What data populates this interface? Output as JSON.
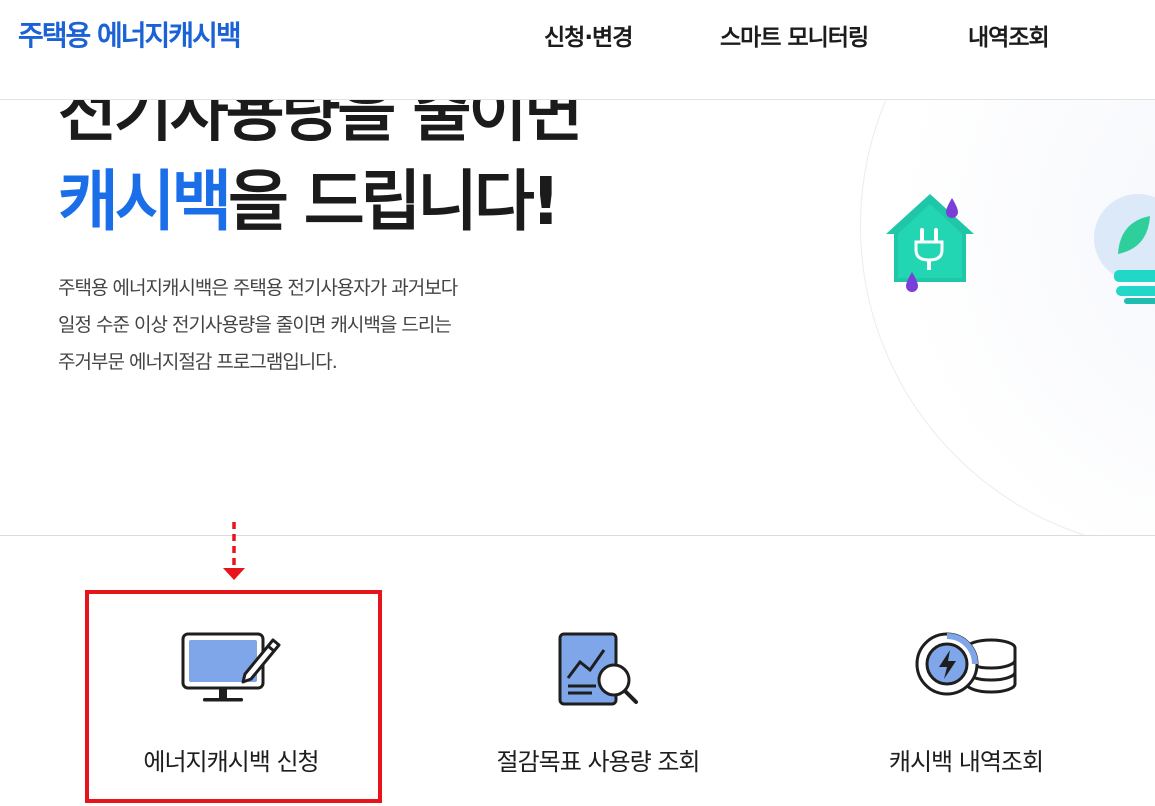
{
  "header": {
    "logo": "주택용 에너지캐시백",
    "nav": [
      "신청·변경",
      "스마트 모니터링",
      "내역조회"
    ]
  },
  "hero": {
    "line1": "전기사용량을 줄이면",
    "line2_accent": "캐시백",
    "line2_rest": "을 드립니다!",
    "description": [
      "주택용 에너지캐시백은 주택용 전기사용자가 과거보다",
      "일정 수준 이상 전기사용량을 줄이면 캐시백을 드리는",
      "주거부문 에너지절감 프로그램입니다."
    ]
  },
  "menu": [
    {
      "label": "에너지캐시백 신청",
      "icon": "monitor-pen-icon"
    },
    {
      "label": "절감목표 사용량 조회",
      "icon": "report-search-icon"
    },
    {
      "label": "캐시백 내역조회",
      "icon": "cashback-coins-icon"
    }
  ],
  "colors": {
    "brand": "#1a62d6",
    "accent": "#1a6ee8",
    "highlight": "#e8141b",
    "icon_blue": "#7fa6e8"
  }
}
